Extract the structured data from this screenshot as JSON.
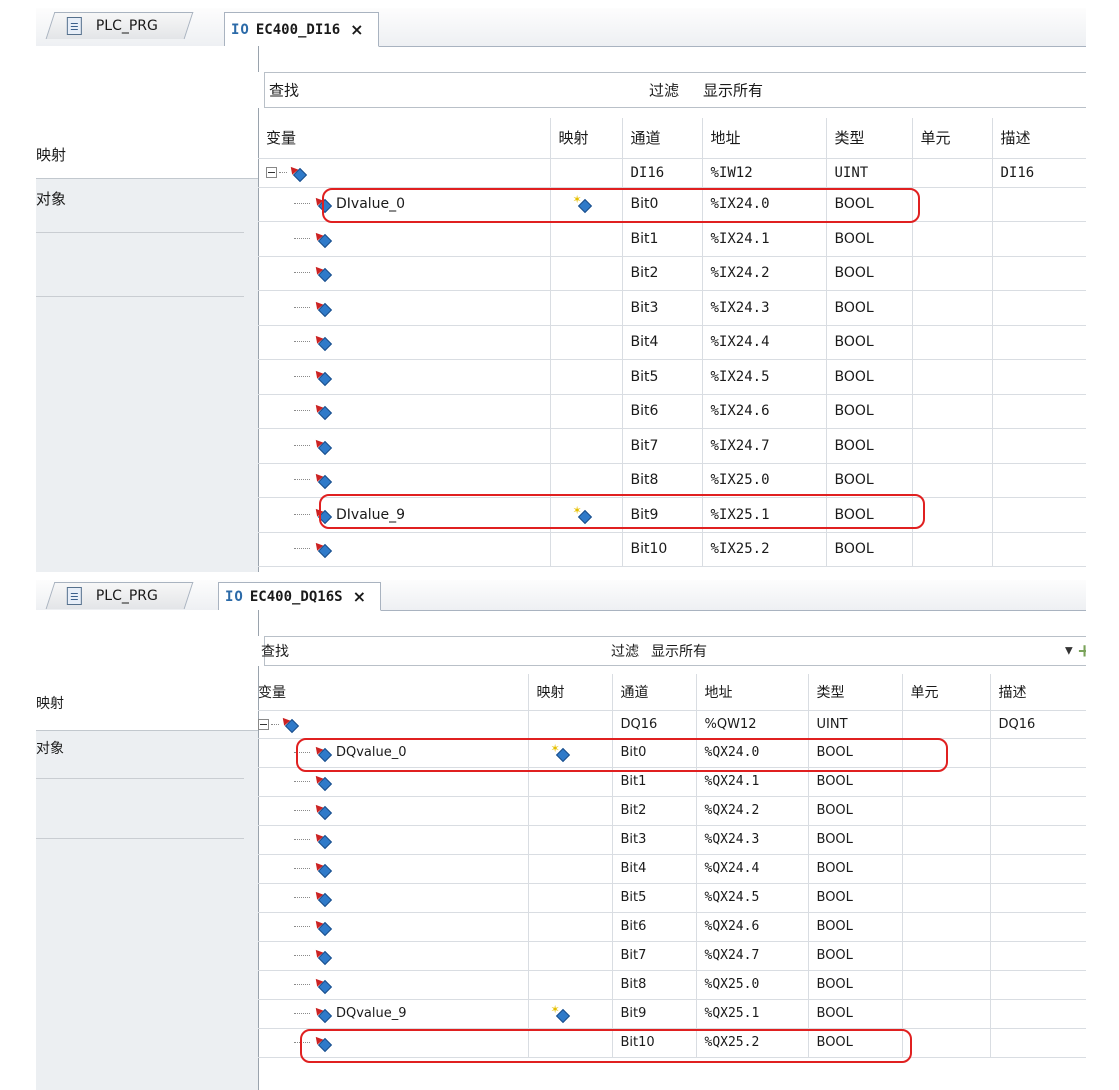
{
  "panels": [
    {
      "tabs": {
        "inactive": "PLC_PRG",
        "io_prefix": "IO",
        "active": "EC400_DI16",
        "close": "×"
      },
      "side": {
        "item1": "映射",
        "item2": "对象"
      },
      "filter": {
        "search": "查找",
        "filter": "过滤",
        "show_all": "显示所有"
      },
      "columns": [
        "变量",
        "映射",
        "通道",
        "地址",
        "类型",
        "单元",
        "描述"
      ],
      "root": {
        "channel": "DI16",
        "address": "%IW12",
        "type": "UINT",
        "desc": "DI16"
      },
      "rows": [
        {
          "var": "DIvalue_0",
          "mapped": true,
          "channel": "Bit0",
          "address": "%IX24.0",
          "type": "BOOL"
        },
        {
          "var": "",
          "mapped": false,
          "channel": "Bit1",
          "address": "%IX24.1",
          "type": "BOOL"
        },
        {
          "var": "",
          "mapped": false,
          "channel": "Bit2",
          "address": "%IX24.2",
          "type": "BOOL"
        },
        {
          "var": "",
          "mapped": false,
          "channel": "Bit3",
          "address": "%IX24.3",
          "type": "BOOL"
        },
        {
          "var": "",
          "mapped": false,
          "channel": "Bit4",
          "address": "%IX24.4",
          "type": "BOOL"
        },
        {
          "var": "",
          "mapped": false,
          "channel": "Bit5",
          "address": "%IX24.5",
          "type": "BOOL"
        },
        {
          "var": "",
          "mapped": false,
          "channel": "Bit6",
          "address": "%IX24.6",
          "type": "BOOL"
        },
        {
          "var": "",
          "mapped": false,
          "channel": "Bit7",
          "address": "%IX24.7",
          "type": "BOOL"
        },
        {
          "var": "",
          "mapped": false,
          "channel": "Bit8",
          "address": "%IX25.0",
          "type": "BOOL"
        },
        {
          "var": "DIvalue_9",
          "mapped": true,
          "channel": "Bit9",
          "address": "%IX25.1",
          "type": "BOOL"
        },
        {
          "var": "",
          "mapped": false,
          "channel": "Bit10",
          "address": "%IX25.2",
          "type": "BOOL"
        }
      ]
    },
    {
      "tabs": {
        "inactive": "PLC_PRG",
        "io_prefix": "IO",
        "active": "EC400_DQ16S",
        "close": "×"
      },
      "side": {
        "item1": "映射",
        "item2": "对象"
      },
      "filter": {
        "search": "查找",
        "filter": "过滤",
        "show_all": "显示所有"
      },
      "columns": [
        "变量",
        "映射",
        "通道",
        "地址",
        "类型",
        "单元",
        "描述"
      ],
      "root": {
        "channel": "DQ16",
        "address": "%QW12",
        "type": "UINT",
        "desc": "DQ16"
      },
      "rows": [
        {
          "var": "DQvalue_0",
          "mapped": true,
          "channel": "Bit0",
          "address": "%QX24.0",
          "type": "BOOL"
        },
        {
          "var": "",
          "mapped": false,
          "channel": "Bit1",
          "address": "%QX24.1",
          "type": "BOOL"
        },
        {
          "var": "",
          "mapped": false,
          "channel": "Bit2",
          "address": "%QX24.2",
          "type": "BOOL"
        },
        {
          "var": "",
          "mapped": false,
          "channel": "Bit3",
          "address": "%QX24.3",
          "type": "BOOL"
        },
        {
          "var": "",
          "mapped": false,
          "channel": "Bit4",
          "address": "%QX24.4",
          "type": "BOOL"
        },
        {
          "var": "",
          "mapped": false,
          "channel": "Bit5",
          "address": "%QX24.5",
          "type": "BOOL"
        },
        {
          "var": "",
          "mapped": false,
          "channel": "Bit6",
          "address": "%QX24.6",
          "type": "BOOL"
        },
        {
          "var": "",
          "mapped": false,
          "channel": "Bit7",
          "address": "%QX24.7",
          "type": "BOOL"
        },
        {
          "var": "",
          "mapped": false,
          "channel": "Bit8",
          "address": "%QX25.0",
          "type": "BOOL"
        },
        {
          "var": "DQvalue_9",
          "mapped": true,
          "channel": "Bit9",
          "address": "%QX25.1",
          "type": "BOOL"
        },
        {
          "var": "",
          "mapped": false,
          "channel": "Bit10",
          "address": "%QX25.2",
          "type": "BOOL"
        }
      ]
    }
  ],
  "colors": {
    "highlight": "#e02020",
    "header_line": "#a9b3c0",
    "input_arrow": "#cc2222",
    "var_diamond": "#2f7ac9"
  }
}
